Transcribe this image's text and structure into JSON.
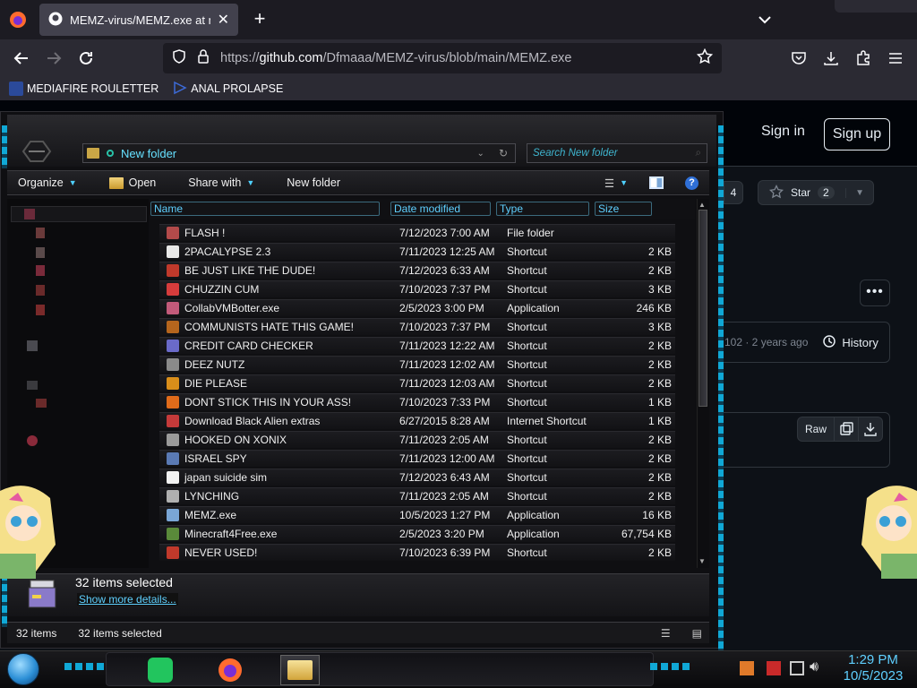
{
  "browser": {
    "tab_title": "MEMZ-virus/MEMZ.exe at main",
    "url_prefix": "https://",
    "url_host": "github.com",
    "url_path": "/Dfmaaa/MEMZ-virus/blob/main/MEMZ.exe",
    "bookmarks": [
      {
        "label": "MEDIAFIRE ROULETTER",
        "icon": "mediafire-icon"
      },
      {
        "label": "ANAL PROLAPSE",
        "icon": "bookmark-icon"
      }
    ]
  },
  "github": {
    "sign_in": "Sign in",
    "sign_up": "Sign up",
    "fork_count": "4",
    "star_label": "Star",
    "star_count": "2",
    "commit_info": "102 · 2 years ago",
    "history_label": "History",
    "raw_label": "Raw"
  },
  "explorer": {
    "address": "New folder",
    "search_placeholder": "Search New folder",
    "commands": {
      "organize": "Organize",
      "open": "Open",
      "share_with": "Share with",
      "new_folder": "New folder"
    },
    "columns": {
      "name": "Name",
      "date": "Date modified",
      "type": "Type",
      "size": "Size"
    },
    "files": [
      {
        "name": "FLASH !",
        "date": "7/12/2023 7:00 AM",
        "type": "File folder",
        "size": "",
        "color": "#b24a4a"
      },
      {
        "name": "2PACALYPSE 2.3",
        "date": "7/11/2023 12:25 AM",
        "type": "Shortcut",
        "size": "2 KB",
        "color": "#e8e8e8"
      },
      {
        "name": "BE JUST LIKE THE DUDE!",
        "date": "7/12/2023 6:33 AM",
        "type": "Shortcut",
        "size": "2 KB",
        "color": "#c0392b"
      },
      {
        "name": "CHUZZIN CUM",
        "date": "7/10/2023 7:37 PM",
        "type": "Shortcut",
        "size": "3 KB",
        "color": "#d63c3c"
      },
      {
        "name": "CollabVMBotter.exe",
        "date": "2/5/2023 3:00 PM",
        "type": "Application",
        "size": "246 KB",
        "color": "#c25a7a"
      },
      {
        "name": "COMMUNISTS HATE THIS GAME!",
        "date": "7/10/2023 7:37 PM",
        "type": "Shortcut",
        "size": "3 KB",
        "color": "#b5651d"
      },
      {
        "name": "CREDIT CARD CHECKER",
        "date": "7/11/2023 12:22 AM",
        "type": "Shortcut",
        "size": "2 KB",
        "color": "#6a6ac9"
      },
      {
        "name": "DEEZ NUTZ",
        "date": "7/11/2023 12:02 AM",
        "type": "Shortcut",
        "size": "2 KB",
        "color": "#8a8a8a"
      },
      {
        "name": "DIE PLEASE",
        "date": "7/11/2023 12:03 AM",
        "type": "Shortcut",
        "size": "2 KB",
        "color": "#d98e1a"
      },
      {
        "name": "DONT STICK THIS IN YOUR ASS!",
        "date": "7/10/2023 7:33 PM",
        "type": "Shortcut",
        "size": "1 KB",
        "color": "#e06b1a"
      },
      {
        "name": "Download Black Alien extras",
        "date": "6/27/2015 8:28 AM",
        "type": "Internet Shortcut",
        "size": "1 KB",
        "color": "#c43a3a"
      },
      {
        "name": "HOOKED ON XONIX",
        "date": "7/11/2023 2:05 AM",
        "type": "Shortcut",
        "size": "2 KB",
        "color": "#9a9a9a"
      },
      {
        "name": "ISRAEL SPY",
        "date": "7/11/2023 12:00 AM",
        "type": "Shortcut",
        "size": "2 KB",
        "color": "#5a7ab5"
      },
      {
        "name": "japan suicide sim",
        "date": "7/12/2023 6:43 AM",
        "type": "Shortcut",
        "size": "2 KB",
        "color": "#f2f2f2"
      },
      {
        "name": "LYNCHING",
        "date": "7/11/2023 2:05 AM",
        "type": "Shortcut",
        "size": "2 KB",
        "color": "#b0b0b0"
      },
      {
        "name": "MEMZ.exe",
        "date": "10/5/2023 1:27 PM",
        "type": "Application",
        "size": "16 KB",
        "color": "#7aa6d6"
      },
      {
        "name": "Minecraft4Free.exe",
        "date": "2/5/2023 3:20 PM",
        "type": "Application",
        "size": "67,754 KB",
        "color": "#5a8a3a"
      },
      {
        "name": "NEVER USED!",
        "date": "7/10/2023 6:39 PM",
        "type": "Shortcut",
        "size": "2 KB",
        "color": "#c0392b"
      }
    ],
    "details_count": "32 items selected",
    "details_more": "Show more details...",
    "status_items": "32 items",
    "status_selected": "32 items selected"
  },
  "taskbar": {
    "time": "1:29 PM",
    "date": "10/5/2023"
  }
}
